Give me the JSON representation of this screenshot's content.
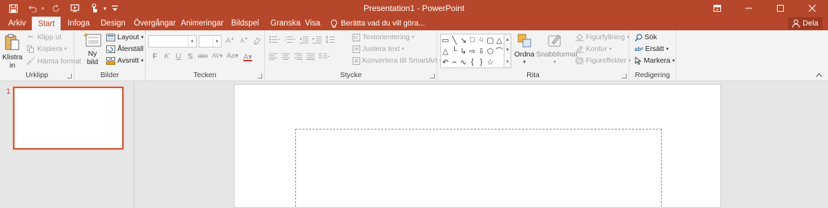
{
  "window": {
    "title": "Presentation1 - PowerPoint"
  },
  "tabs": [
    {
      "label": "Arkiv"
    },
    {
      "label": "Start"
    },
    {
      "label": "Infoga"
    },
    {
      "label": "Design"
    },
    {
      "label": "Övergångar"
    },
    {
      "label": "Animeringar"
    },
    {
      "label": "Bildspel"
    },
    {
      "label": "Granska"
    },
    {
      "label": "Visa"
    }
  ],
  "tell_me": "Berätta vad du vill göra...",
  "share_label": "Dela",
  "groups": {
    "clipboard": {
      "label": "Urklipp",
      "paste": "Klistra in",
      "cut": "Klipp ut",
      "copy": "Kopiera",
      "format_painter": "Hämta format"
    },
    "slides": {
      "label": "Bilder",
      "new_slide": "Ny bild",
      "layout": "Layout",
      "reset": "Återställ",
      "section": "Avsnitt"
    },
    "font": {
      "label": "Tecken"
    },
    "paragraph": {
      "label": "Stycke",
      "text_direction": "Textorientering",
      "align_text": "Justera text",
      "smartart": "Konvertera till SmartArt"
    },
    "drawing": {
      "label": "Rita",
      "arrange": "Ordna",
      "quick_styles": "Snabbformat",
      "shape_fill": "Figurfyllning",
      "shape_outline": "Kontur",
      "shape_effects": "Figureffekter"
    },
    "editing": {
      "label": "Redigering",
      "find": "Sök",
      "replace": "Ersätt",
      "select": "Markera"
    }
  },
  "thumbnails": [
    {
      "number": "1"
    }
  ],
  "colors": {
    "accent": "#b7472a",
    "selection": "#d35230"
  }
}
